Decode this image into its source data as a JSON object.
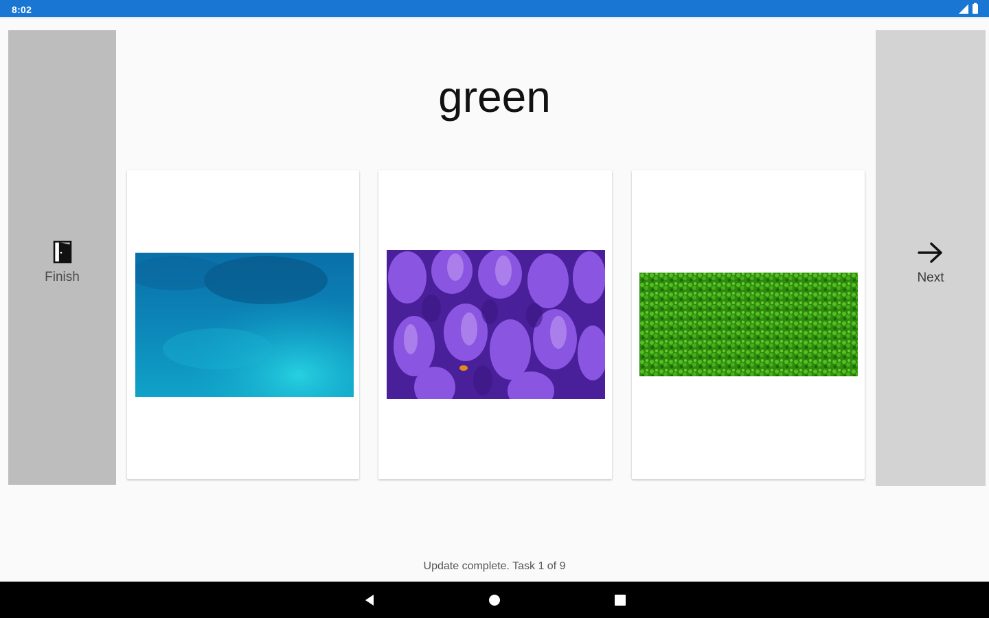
{
  "status_bar": {
    "time": "8:02",
    "background": "#1976d2",
    "icons": [
      "signal-icon",
      "battery-icon"
    ]
  },
  "finish_button": {
    "label": "Finish",
    "icon": "exit-door-icon",
    "background": "#bdbdbd"
  },
  "next_button": {
    "label": "Next",
    "icon": "arrow-right-icon",
    "background": "#d3d3d3"
  },
  "prompt": {
    "word": "green"
  },
  "choices": [
    {
      "icon": "blue-water-photo",
      "dominant_color": "#0a8ec0"
    },
    {
      "icon": "purple-crocus-photo",
      "dominant_color": "#7a3fd0"
    },
    {
      "icon": "green-clover-photo",
      "dominant_color": "#3a9a10"
    }
  ],
  "status_message": "Update complete. Task 1 of 9",
  "nav_bar": {
    "icons": [
      "back-icon",
      "home-icon",
      "recents-icon"
    ]
  }
}
